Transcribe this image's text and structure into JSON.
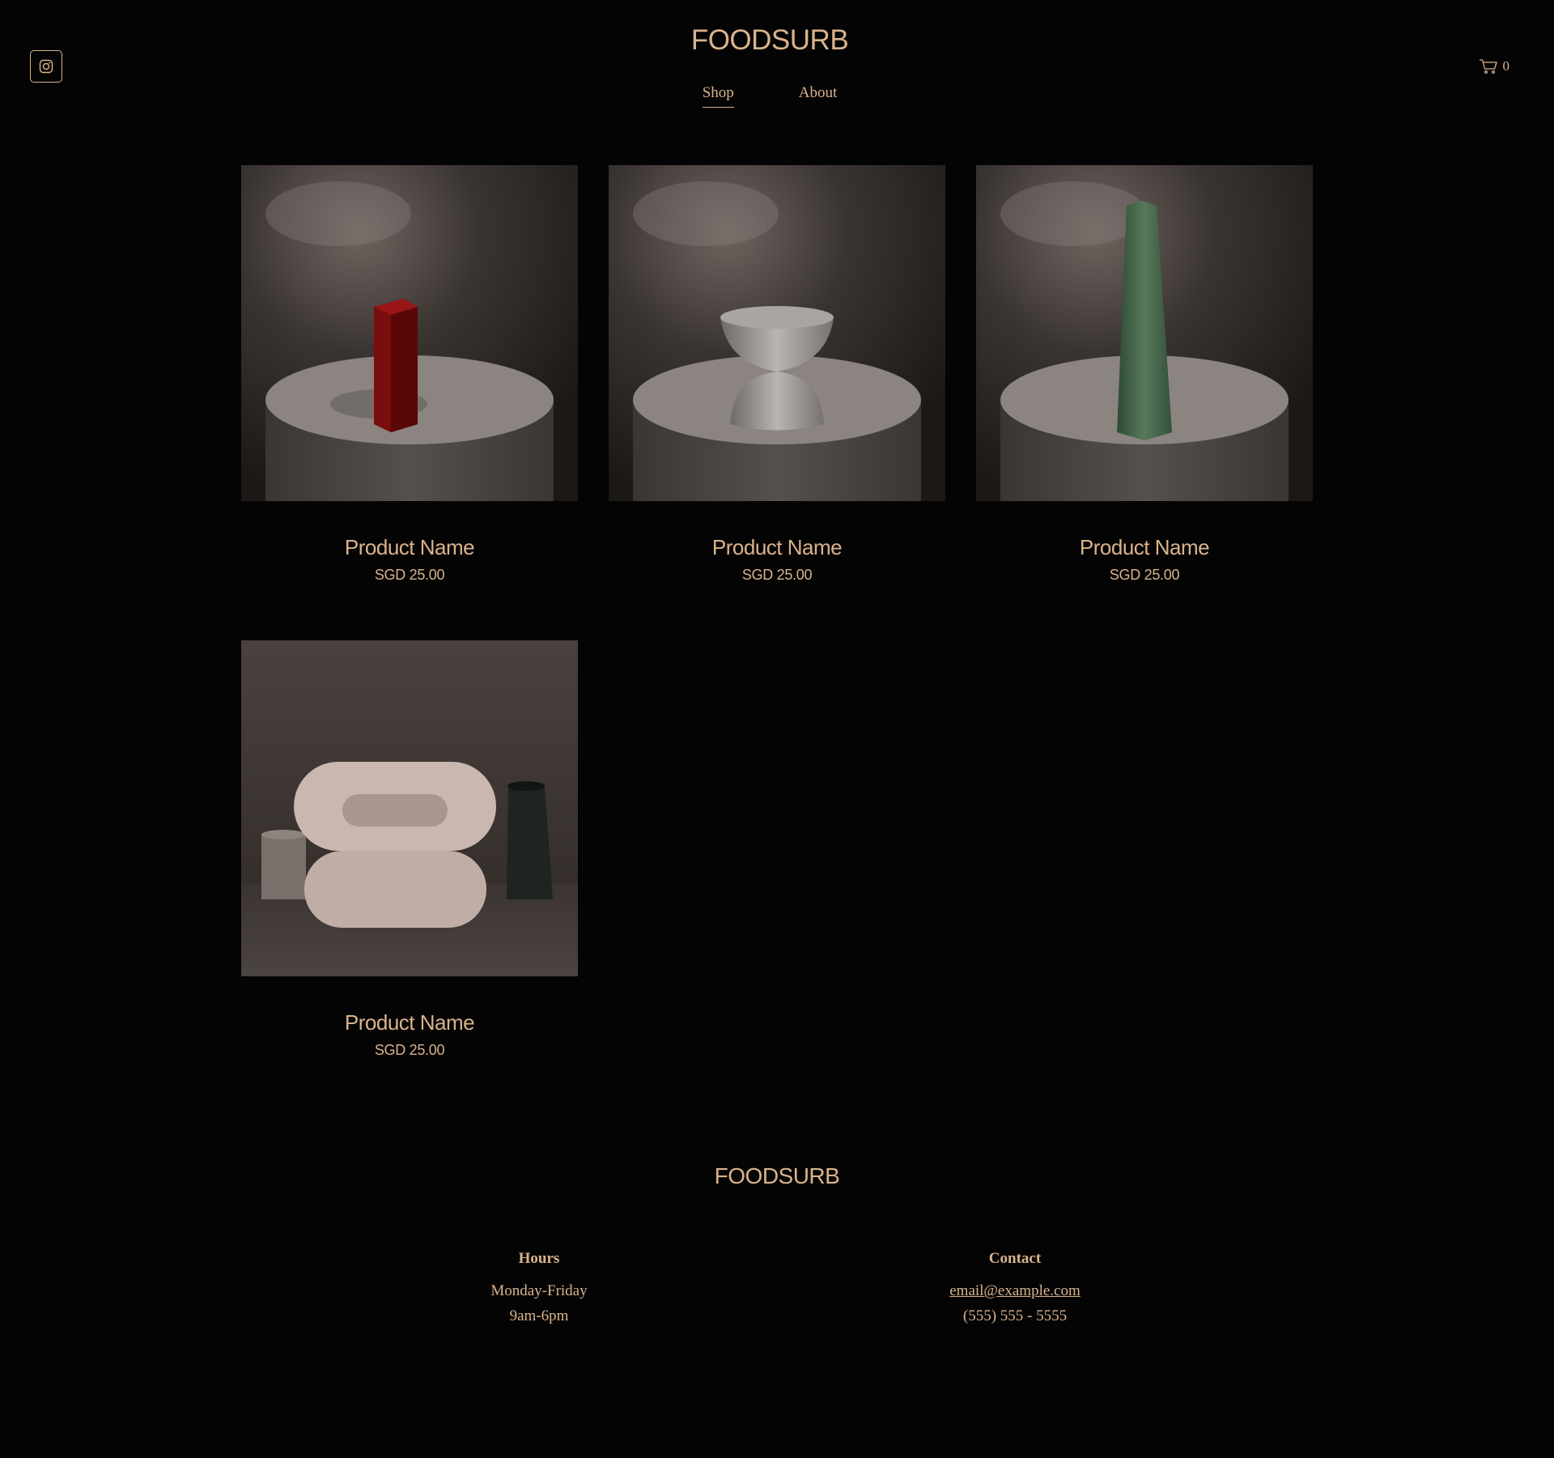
{
  "header": {
    "brand": "FOODSURB",
    "nav": [
      {
        "label": "Shop",
        "active": true
      },
      {
        "label": "About",
        "active": false
      }
    ],
    "cart_count": "0"
  },
  "products": [
    {
      "name": "Product Name",
      "price": "SGD 25.00"
    },
    {
      "name": "Product Name",
      "price": "SGD 25.00"
    },
    {
      "name": "Product Name",
      "price": "SGD 25.00"
    },
    {
      "name": "Product Name",
      "price": "SGD 25.00"
    }
  ],
  "footer": {
    "brand": "FOODSURB",
    "hours": {
      "title": "Hours",
      "line1": "Monday-Friday",
      "line2": "9am-6pm"
    },
    "contact": {
      "title": "Contact",
      "email": "email@example.com",
      "phone": "(555) 555 - 5555"
    }
  },
  "colors": {
    "background": "#050404",
    "accent": "#d9b38c"
  }
}
